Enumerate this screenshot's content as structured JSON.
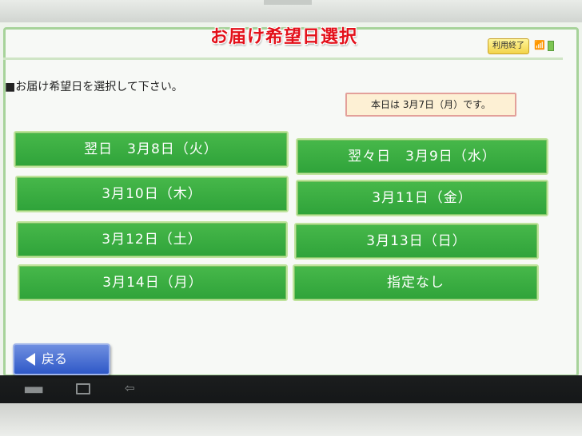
{
  "header": {
    "title": "お届け希望日選択",
    "exit_label": "利用終了",
    "wifi_icon": "wifi-icon",
    "battery_icon": "battery-icon"
  },
  "instruction": "■お届け希望日を選択して下さい。",
  "today_notice": "本日は 3月7日（月）です。",
  "dates": [
    {
      "label": "翌日　3月8日（火）"
    },
    {
      "label": "翌々日　3月9日（水）"
    },
    {
      "label": "3月10日（木）"
    },
    {
      "label": "3月11日（金）"
    },
    {
      "label": "3月12日（土）"
    },
    {
      "label": "3月13日（日）"
    },
    {
      "label": "3月14日（月）"
    },
    {
      "label": "指定なし"
    }
  ],
  "back_label": "戻る",
  "colors": {
    "title_red": "#e3101a",
    "button_green": "#3aab3f",
    "back_blue": "#2e58c7",
    "exit_yellow": "#f3d44a"
  }
}
